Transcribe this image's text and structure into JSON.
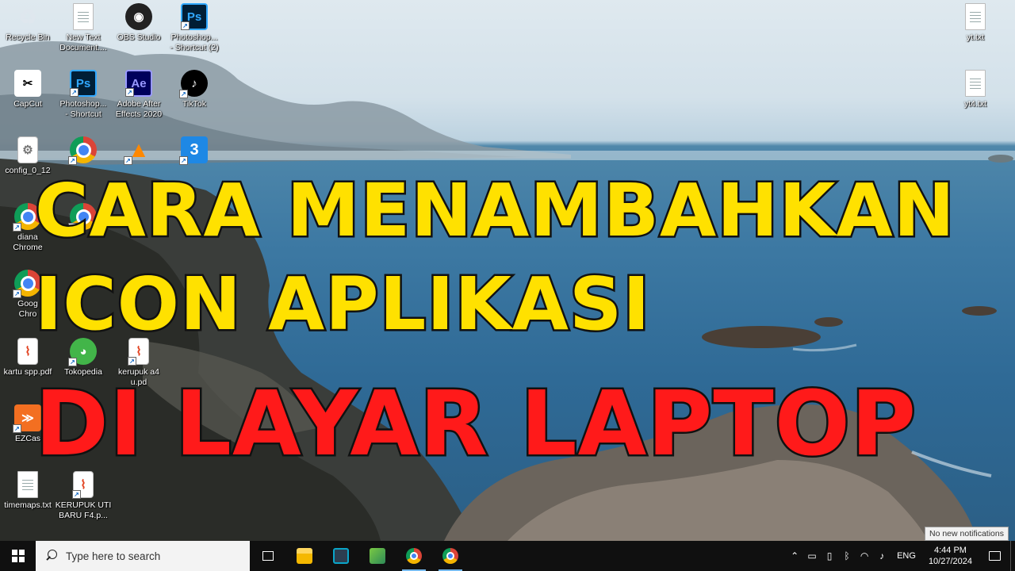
{
  "desktop_icons": [
    {
      "label": "Recycle Bin",
      "icon": "recycle-bin-icon",
      "glyph": "♻"
    },
    {
      "label": "New Text\nDocument....",
      "icon": "text-document-icon",
      "glyph": ""
    },
    {
      "label": "OBS Studio",
      "icon": "obs-studio-icon",
      "glyph": "◉"
    },
    {
      "label": "Photoshop...\n- Shortcut (2)",
      "icon": "photoshop-icon",
      "glyph": "Ps"
    },
    {
      "label": "CapCut",
      "icon": "capcut-icon",
      "glyph": "✂"
    },
    {
      "label": "Photoshop...\n- Shortcut",
      "icon": "photoshop-icon",
      "glyph": "Ps"
    },
    {
      "label": "Adobe After\nEffects 2020",
      "icon": "after-effects-icon",
      "glyph": "Ae"
    },
    {
      "label": "TikTok",
      "icon": "tiktok-icon",
      "glyph": "♪"
    },
    {
      "label": "config_0_12",
      "icon": "config-file-icon",
      "glyph": "⚙"
    },
    {
      "label": "",
      "icon": "chrome-icon",
      "glyph": ""
    },
    {
      "label": "",
      "icon": "vlc-icon",
      "glyph": "▲"
    },
    {
      "label": "",
      "icon": "blue-app-icon",
      "glyph": "3"
    },
    {
      "label": "diana\nChrome",
      "icon": "chrome-icon",
      "glyph": ""
    },
    {
      "label": "",
      "icon": "chrome-icon",
      "glyph": ""
    },
    {
      "label": "Goog\nChro",
      "icon": "chrome-icon",
      "glyph": ""
    },
    {
      "label": "kartu spp.pdf",
      "icon": "pdf-icon",
      "glyph": "⌇"
    },
    {
      "label": "Tokopedia",
      "icon": "tokopedia-icon",
      "glyph": "◕"
    },
    {
      "label": "kerupuk a4\nu.pd",
      "icon": "pdf-icon",
      "glyph": "⌇"
    },
    {
      "label": "EZCas",
      "icon": "ezcast-icon",
      "glyph": "≫"
    },
    {
      "label": "timemaps.txt",
      "icon": "text-document-icon",
      "glyph": ""
    },
    {
      "label": "KERUPUK UTI\nBARU F4.p...",
      "icon": "pdf-icon",
      "glyph": "⌇"
    },
    {
      "label": "yt.txt",
      "icon": "text-document-icon",
      "glyph": ""
    },
    {
      "label": "yt4.txt",
      "icon": "text-document-icon",
      "glyph": ""
    }
  ],
  "overlay": {
    "line1": "CARA MENAMBAHKAN",
    "line2": "ICON APLIKASI",
    "line3": "DI LAYAR LAPTOP",
    "colors": {
      "yellow": "#ffe100",
      "red": "#ff1a1a",
      "outline": "#111111"
    }
  },
  "tooltip": "No new notifications",
  "taskbar": {
    "search_placeholder": "Type here to search",
    "apps": [
      "task-view",
      "file-explorer",
      "store",
      "green-app",
      "chrome",
      "chrome-profile"
    ],
    "language": "ENG",
    "time": "4:44 PM",
    "date": "10/27/2024"
  }
}
